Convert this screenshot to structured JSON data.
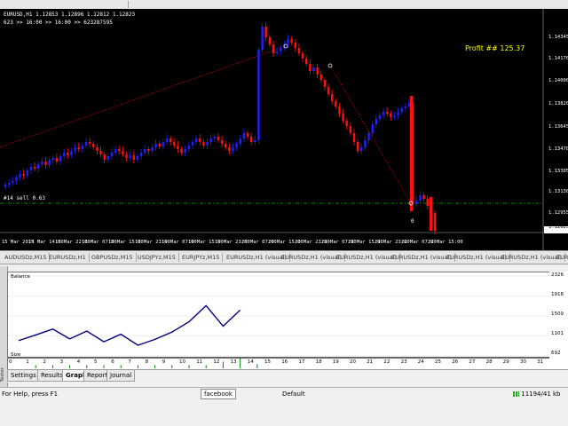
{
  "window": {
    "header_line1": "EURUSD,H1  1.12853 1.12896 1.12812 1.12823",
    "header_line2": "623  >> 16:00  >> 16:00  >> 623287595",
    "profit_label": "Profit ## 125.37",
    "order_label": "#14 sell 0.63",
    "order_marker": "0"
  },
  "price_axis": [
    "1.14345",
    "1.14170",
    "1.14000",
    "1.13820",
    "1.13645",
    "1.13470",
    "1.13305",
    "1.13130",
    "1.12955",
    "1.12823"
  ],
  "time_axis": [
    "15 Mar 2019",
    "15 Mar 14:00",
    "15 Mar 22:00",
    "18 Mar 07:00",
    "18 Mar 15:00",
    "18 Mar 23:00",
    "19 Mar 07:00",
    "19 Mar 15:00",
    "19 Mar 23:00",
    "20 Mar 07:00",
    "20 Mar 15:00",
    "20 Mar 23:00",
    "21 Mar 07:00",
    "21 Mar 15:00",
    "21 Mar 23:00",
    "22 Mar 07:00",
    "22 Mar 15:00"
  ],
  "chart_tabs": [
    "AUDUSDz,M15",
    "EURUSDz,H1",
    "GBPUSDz,M15",
    "USDJPYz,M15",
    "EURJPYz,M15",
    "EURUSDz,H1 (visual)",
    "EURUSDz,H1 (visual)",
    "EURUSDz,H1 (visual)",
    "EURUSDz,H1 (visual)",
    "EURUSDz,H1 (visual)",
    "EURUSDz,H1 (visual)",
    "EURUSDz,H1 (visual)",
    "EURUSDz,H1 (vi"
  ],
  "tester": {
    "side_label": "Tester",
    "balance_label": "Balance",
    "size_label": "Size",
    "y_axis": [
      "2326",
      "1918",
      "1509",
      "1101",
      "692"
    ],
    "x_axis": [
      "0",
      "1",
      "2",
      "3",
      "4",
      "5",
      "6",
      "7",
      "8",
      "9",
      "10",
      "11",
      "12",
      "13",
      "14",
      "15",
      "16",
      "17",
      "18",
      "19",
      "20",
      "21",
      "22",
      "23",
      "24",
      "25",
      "26",
      "27",
      "28",
      "29",
      "30",
      "31"
    ],
    "balance_series": [
      1005,
      1120,
      1240,
      1040,
      1200,
      980,
      1135,
      910,
      1030,
      1180,
      1390,
      1720,
      1300,
      1630
    ],
    "size_series": [
      0.3,
      0.3,
      0.3,
      0.3,
      0.3,
      0.3,
      0.3,
      0.3,
      0.3,
      0.3,
      0.3,
      0.63,
      0.96,
      0.4
    ],
    "tabs": [
      "Settings",
      "Results",
      "Graph",
      "Report",
      "Journal"
    ],
    "active_tab": "Graph"
  },
  "status": {
    "help": "For Help, press F1",
    "facebook": "facebook",
    "profile": "Default",
    "traffic": "11194/41 kb"
  },
  "colors": {
    "bull": "#1f1fff",
    "bear": "#ff1010",
    "level_line": "#00c000",
    "balance_line": "#000080",
    "profit_text": "#ffff00"
  }
}
